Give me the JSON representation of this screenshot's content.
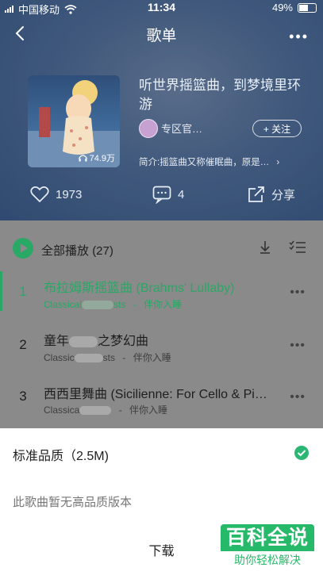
{
  "status_bar": {
    "carrier": "中国移动",
    "time": "11:34",
    "battery": "49%"
  },
  "nav": {
    "title": "歌单"
  },
  "playlist": {
    "title": "听世界摇篮曲，到梦境里环游",
    "play_count": "74.9万",
    "creator": "专区官…",
    "follow_label": "+ 关注",
    "intro": "简介:摇篮曲又称催眠曲，原是…"
  },
  "actions": {
    "likes": "1973",
    "comments": "4",
    "share_label": "分享"
  },
  "play_all": {
    "label": "全部播放",
    "count": "(27)"
  },
  "songs": [
    {
      "num": "1",
      "title": "布拉姆斯摇篮曲 (Brahms' Lullaby)",
      "artist": "Classical",
      "artist_tail": "sts",
      "tag": "伴你入睡"
    },
    {
      "num": "2",
      "title": "童年",
      "title_tail": "之梦幻曲",
      "artist": "Classic",
      "artist_tail": "sts",
      "tag": "伴你入睡"
    },
    {
      "num": "3",
      "title": "西西里舞曲 (Sicilienne: For Cello & Pi…",
      "artist": "Classica",
      "tag": "伴你入睡"
    }
  ],
  "sheet": {
    "quality": "标准品质（2.5M)",
    "no_hq": "此歌曲暂无高品质版本",
    "download": "下载"
  },
  "watermark": {
    "main": "百科全说",
    "sub": "助你轻松解决"
  },
  "colors": {
    "accent": "#29a866",
    "header": "#4f6d98"
  }
}
